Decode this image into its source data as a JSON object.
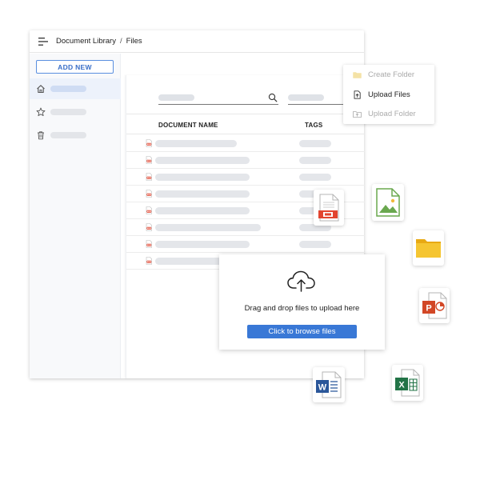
{
  "header": {
    "breadcrumb": [
      "Document Library",
      "Files"
    ],
    "separator": "/"
  },
  "sidebar": {
    "add_new_label": "ADD NEW",
    "items": [
      {
        "icon": "home-icon",
        "active": true
      },
      {
        "icon": "star-icon",
        "active": false
      },
      {
        "icon": "trash-icon",
        "active": false
      }
    ]
  },
  "table": {
    "columns": [
      "DOCUMENT NAME",
      "TAGS"
    ],
    "row_count": 8
  },
  "context_menu": {
    "items": [
      {
        "label": "Create Folder",
        "icon": "folder-icon",
        "enabled": false
      },
      {
        "label": "Upload Files",
        "icon": "file-upload-icon",
        "enabled": true
      },
      {
        "label": "Upload Folder",
        "icon": "folder-upload-icon",
        "enabled": false
      }
    ]
  },
  "upload_dialog": {
    "message": "Drag and drop files to upload here",
    "browse_label": "Click to browse files"
  },
  "colors": {
    "accent": "#3978d6",
    "pdf": "#e2442f",
    "image": "#6aa84f",
    "folder": "#f5c531",
    "powerpoint": "#d24726",
    "word": "#2b579a",
    "excel": "#217346"
  },
  "floating_files": [
    "pdf-file-icon",
    "image-file-icon",
    "folder-file-icon",
    "powerpoint-file-icon",
    "word-file-icon",
    "excel-file-icon"
  ]
}
